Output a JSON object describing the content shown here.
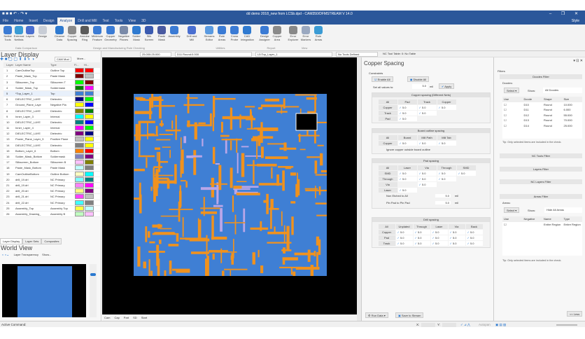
{
  "title": "dd demo 2018_new from LCSb.dpd - CAM350/DFMSTREAM V 14.0",
  "style_label": "Style",
  "menu": [
    "File",
    "Home",
    "Insert",
    "Design",
    "Analyze",
    "Drill and Mill",
    "Test",
    "Tools",
    "View",
    "3D"
  ],
  "active_menu": "Analyze",
  "ribbon": [
    {
      "label": "Netlist Tools",
      "color": "#3b7bd4"
    },
    {
      "label": "External Netlists",
      "color": "#3b9bd4"
    },
    {
      "label": "Layers",
      "color": "#4a6fd0"
    },
    {
      "label": "Design",
      "color": "#c8cdd6"
    },
    {
      "label": "Cleanse Data",
      "color": "#2f7ad0"
    },
    {
      "label": "Copper Spacing",
      "color": "#8a8a8a"
    },
    {
      "label": "Annular Ring",
      "color": "#5a5a5a"
    },
    {
      "label": "Minimum Feature",
      "color": "#3b7bd4"
    },
    {
      "label": "Copper Geometry",
      "color": "#3b7bd4"
    },
    {
      "label": "Negative Planes",
      "color": "#7a8aa8"
    },
    {
      "label": "Solder Mask",
      "color": "#2f7ad0"
    },
    {
      "label": "Silk Screen",
      "color": "#3b5bb0"
    },
    {
      "label": "Paste Mask",
      "color": "#4a5aa0"
    },
    {
      "label": "Assembly",
      "color": "#3b7bd4"
    },
    {
      "label": "Drill and Mill",
      "color": "#4a6fd0"
    },
    {
      "label": "Streams Editor",
      "color": "#5a9ae0"
    },
    {
      "label": "Rule Areas",
      "color": "#3b7bd4"
    },
    {
      "label": "Cross Probe",
      "color": "#3b7bd4"
    },
    {
      "label": "CAD Integration",
      "color": "#2f7ad0"
    },
    {
      "label": "Design Assigner",
      "color": "#3b7bd4"
    },
    {
      "label": "Copper Area",
      "color": "#8a8a8a"
    },
    {
      "label": "Error Explorer",
      "color": "#888888"
    },
    {
      "label": "Error Markers",
      "color": "#9aa8c0"
    },
    {
      "label": "Rule Areas",
      "color": "#3b9bd4"
    }
  ],
  "ribbon_groups": [
    "Data Comparison",
    "Design and Manufacturing Rule Checking",
    "Utilities",
    "Report",
    "View"
  ],
  "toolbar": {
    "grid": "25.000:25.000",
    "dcode": "D11 Round:0.000",
    "layer": "L5:Top_Layer_1",
    "tools": "No Tools Defined",
    "nc_table": "NC Tool Table: 0: No Table"
  },
  "layer_display": {
    "title": "Layer Display",
    "cam_mode": "CAM Mod",
    "more": "More...",
    "headers": [
      "Layer",
      "Layer Name",
      "Type",
      "Fi...",
      "Hi..."
    ],
    "rows": [
      {
        "n": "1",
        "name": "CamOutlineTop",
        "type": "Outline Top",
        "c1": "#ff0000",
        "c2": "#ff0000"
      },
      {
        "n": "2",
        "name": "Paste_Mask_Top",
        "type": "Paste Mask",
        "c1": "#800000",
        "c2": "#c0c0c0"
      },
      {
        "n": "3",
        "name": "Silkscreen_Top",
        "type": "Silkscreen T",
        "c1": "#00ff00",
        "c2": "#800000"
      },
      {
        "n": "4",
        "name": "Solder_Mask_Top",
        "type": "Soldermask",
        "c1": "#008000",
        "c2": "#ff00ff"
      },
      {
        "n": "5",
        "name": "*Top_Layer_1",
        "type": "Top",
        "c1": "#3f7fd4",
        "c2": "#3f7fd4"
      },
      {
        "n": "6",
        "name": "DIELECTRIC_LAYE",
        "type": "Dielectric",
        "c1": "#000080",
        "c2": "#00ff00"
      },
      {
        "n": "7",
        "name": "Ground_Plane_Laye",
        "type": "Negative Pla",
        "c1": "#ffff00",
        "c2": "#0000ff"
      },
      {
        "n": "8",
        "name": "DIELECTRIC_LAYE",
        "type": "Dielectric",
        "c1": "#808000",
        "c2": "#008000"
      },
      {
        "n": "9",
        "name": "Inner_Layer_3",
        "type": "Internal",
        "c1": "#00ffff",
        "c2": "#ffff00"
      },
      {
        "n": "10",
        "name": "DIELECTRIC_LAYE",
        "type": "Dielectric",
        "c1": "#008080",
        "c2": "#0000ff"
      },
      {
        "n": "11",
        "name": "Inner_Layer_4",
        "type": "Internal",
        "c1": "#ff00ff",
        "c2": "#00ff00"
      },
      {
        "n": "12",
        "name": "DIELECTRIC_LAYE",
        "type": "Dielectric",
        "c1": "#800080",
        "c2": "#000080"
      },
      {
        "n": "13",
        "name": "Power_Plane_Layer_5",
        "type": "Positive Plane",
        "c1": "#c0c0c0",
        "c2": "#ffff00"
      },
      {
        "n": "14",
        "name": "DIELECTRIC_LAYE",
        "type": "Dielectric",
        "c1": "#808080",
        "c2": "#ffff00"
      },
      {
        "n": "15",
        "name": "Bottom_Layer_6",
        "type": "Bottom",
        "c1": "#ff8000",
        "c2": "#ff0000"
      },
      {
        "n": "16",
        "name": "Solder_Mask_Bottom",
        "type": "Soldermask",
        "c1": "#8080c0",
        "c2": "#800080"
      },
      {
        "n": "17",
        "name": "Silkscreen_Bottom",
        "type": "Silkscreen B",
        "c1": "#ffc0ff",
        "c2": "#808000"
      },
      {
        "n": "18",
        "name": "Paste_Mask_Bottom",
        "type": "Paste Mask",
        "c1": "#c0ffff",
        "c2": "#808080"
      },
      {
        "n": "19",
        "name": "CamOutlineBottom",
        "type": "Outline Bottom",
        "c1": "#ffffc0",
        "c2": "#00ffff"
      },
      {
        "n": "20",
        "name": "drill_19.drl",
        "type": "NC Primary",
        "c1": "#80ffff",
        "c2": "#008080"
      },
      {
        "n": "21",
        "name": "drill_19.drl",
        "type": "NC Primary",
        "c1": "#ff80ff",
        "c2": "#ff00ff"
      },
      {
        "n": "22",
        "name": "drill_20.drl",
        "type": "NC Primary",
        "c1": "#ffff80",
        "c2": "#800080"
      },
      {
        "n": "23",
        "name": "drill_21.drl",
        "type": "NC Primary",
        "c1": "#ff40ff",
        "c2": "#c0c0c0"
      },
      {
        "n": "24",
        "name": "drill_22.drl",
        "type": "NC Primary",
        "c1": "#40ffff",
        "c2": "#808080"
      },
      {
        "n": "25",
        "name": "Assembly_Top",
        "type": "Assembly Top",
        "c1": "#ffff40",
        "c2": "#c0ffff"
      },
      {
        "n": "26",
        "name": "Assembly_Drawing_",
        "type": "Assembly B",
        "c1": "#c0ffc0",
        "c2": "#ffc0ff"
      }
    ],
    "tabs": [
      "Layer Display",
      "Layer Sets",
      "Composites"
    ]
  },
  "world_view": {
    "title": "World View",
    "transparency": "Layer Transparency",
    "show": "Show..."
  },
  "canvas_tabs": [
    "Cam",
    "Cap",
    "Part",
    "SD",
    "Start"
  ],
  "status": {
    "command": "Active Command:",
    "x_label": "X:",
    "y_label": "Y:",
    "autopan": "Autopan"
  },
  "copper_spacing": {
    "title": "Copper Spacing",
    "constraints": "Constraints",
    "enable_all": "Enable All",
    "disable_all": "Disable All",
    "set_all": "Set all values to:",
    "set_value": "5.0",
    "unit": "mil",
    "apply": "Apply",
    "diff_nets": {
      "title": "Copper spacing (Different Nets)",
      "cols": [
        "All",
        "Pad",
        "Track",
        "Copper"
      ],
      "rows": [
        [
          "Copper",
          "5.0",
          "5.0",
          "5.0"
        ],
        [
          "Track",
          "5.0",
          "5.0",
          ""
        ],
        [
          "Pad",
          "5.0",
          "",
          ""
        ]
      ]
    },
    "board_outline": {
      "title": "Board outline spacing",
      "cols": [
        "All",
        "Board",
        "Mill Path",
        "Mill Tab"
      ],
      "rows": [
        [
          "Copper",
          "5.0",
          "5.0",
          "5.0"
        ]
      ],
      "ignore": "Ignore copper outside board outline"
    },
    "pad": {
      "title": "Pad spacing",
      "cols": [
        "All",
        "Laser",
        "Via",
        "Through",
        "SMD"
      ],
      "rows": [
        [
          "SMD",
          "5.0",
          "5.0",
          "5.0",
          "5.0"
        ],
        [
          "Through",
          "5.0",
          "5.0",
          "5.0",
          ""
        ],
        [
          "Via",
          "",
          "5.0",
          "",
          ""
        ],
        [
          "Laser",
          "5.0",
          "",
          "",
          ""
        ]
      ],
      "non_etched": "Non Etched to All",
      "non_etched_val": "5.0",
      "pin_pad": "Pin Pad to Pin Pad",
      "pin_pad_val": "5.0",
      "unit": "mil"
    },
    "drill": {
      "title": "Drill spacing",
      "cols": [
        "All",
        "Unplated",
        "Through",
        "Laser",
        "Via",
        "Back"
      ],
      "rows": [
        [
          "Copper",
          "5.0",
          "5.0",
          "5.0",
          "5.0",
          "5.0"
        ],
        [
          "Pad",
          "5.0",
          "5.0",
          "5.0",
          "5.0",
          "5.0"
        ],
        [
          "Track",
          "5.0",
          "5.0",
          "5.0",
          "5.0",
          "5.0"
        ]
      ]
    },
    "run_data": "Run Data",
    "save_stream": "Save to Stream"
  },
  "filters": {
    "title": "Filters",
    "dcodes_filter": "Dcodes Filter",
    "dcodes_label": "Dcodes:",
    "select": "Select",
    "show": "Show:",
    "dcodes_show": "All Dcodes",
    "dcode_cols": [
      "Use",
      "Dcode",
      "Shape",
      "Size"
    ],
    "dcode_rows": [
      [
        "D10",
        "Round",
        "10.000"
      ],
      [
        "D11",
        "Round",
        "6.000"
      ],
      [
        "D12",
        "Round",
        "55.000"
      ],
      [
        "D13",
        "Round",
        "70.000"
      ],
      [
        "D14",
        "Round",
        "25.000"
      ]
    ],
    "tip": "Tip: Only selected items are included in the check.",
    "nc_tools": "NC Tools Filter",
    "layers": "Layers Filter",
    "nc_layers": "NC Layers Filter",
    "areas": "Areas Filter",
    "areas_label": "Areas:",
    "areas_show": "Hide All Areas",
    "area_cols": [
      "Use",
      "Negative",
      "Name",
      "Type"
    ],
    "area_rows": [
      [
        "",
        "Entire Region",
        "Entire Region"
      ]
    ],
    "less": "<< Less"
  }
}
